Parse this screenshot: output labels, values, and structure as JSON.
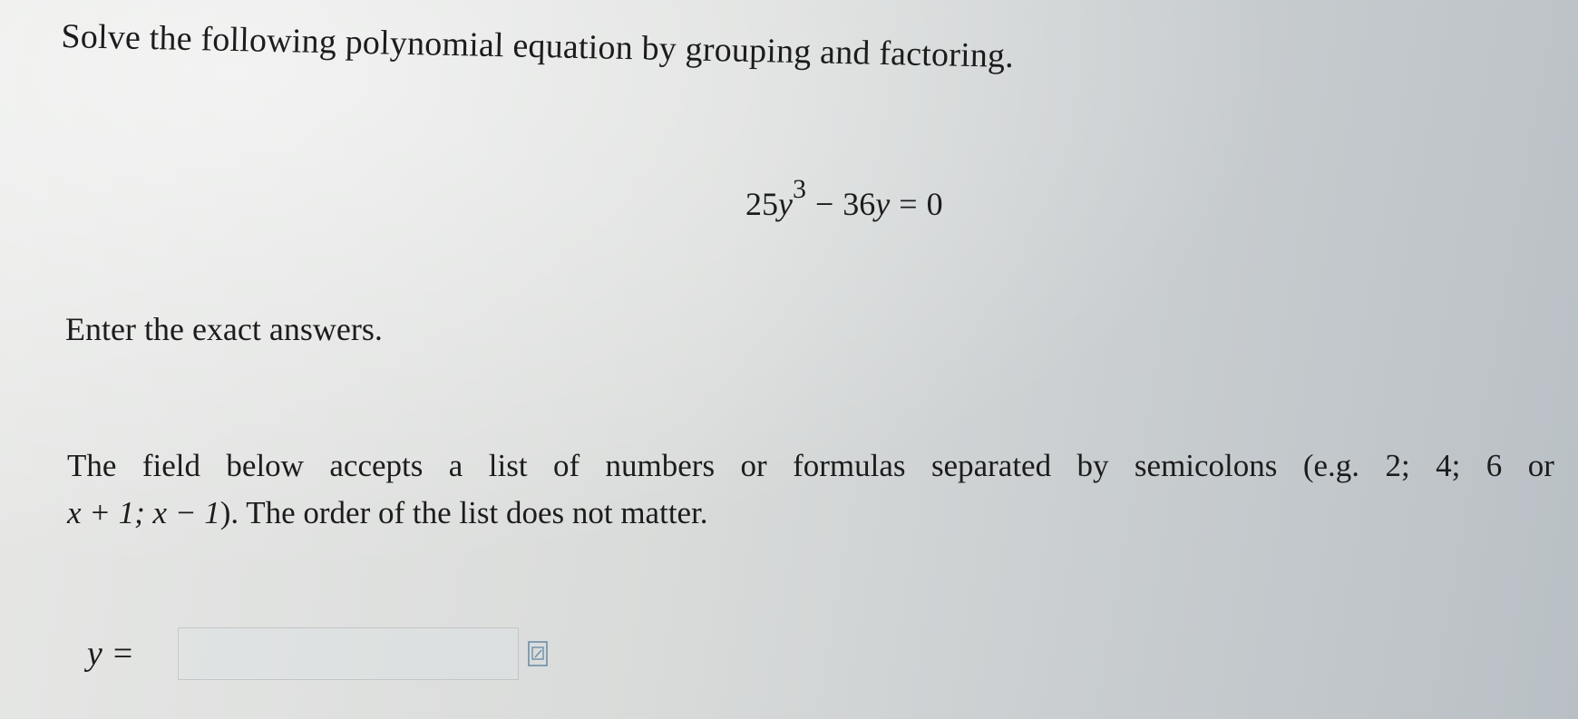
{
  "question": {
    "heading": "Solve the following polynomial equation by grouping and factoring.",
    "equation": {
      "coef1": "25",
      "var1": "y",
      "exp1": "3",
      "op1": "−",
      "coef2": "36",
      "var2": "y",
      "op2": "=",
      "rhs": "0"
    },
    "instruction": "Enter the exact answers.",
    "note": {
      "words_line1": [
        "The",
        "field",
        "below",
        "accepts",
        "a",
        "list",
        "of",
        "numbers",
        "or",
        "formulas",
        "separated",
        "by",
        "semicolons",
        "(e.g.",
        "2;",
        "4;",
        "6",
        "or"
      ],
      "line2_math": "x + 1; x − 1",
      "line2_end": "). The order of the list does not matter."
    }
  },
  "answer": {
    "label": "y =",
    "value": "",
    "icon": "formula-editor-icon"
  }
}
